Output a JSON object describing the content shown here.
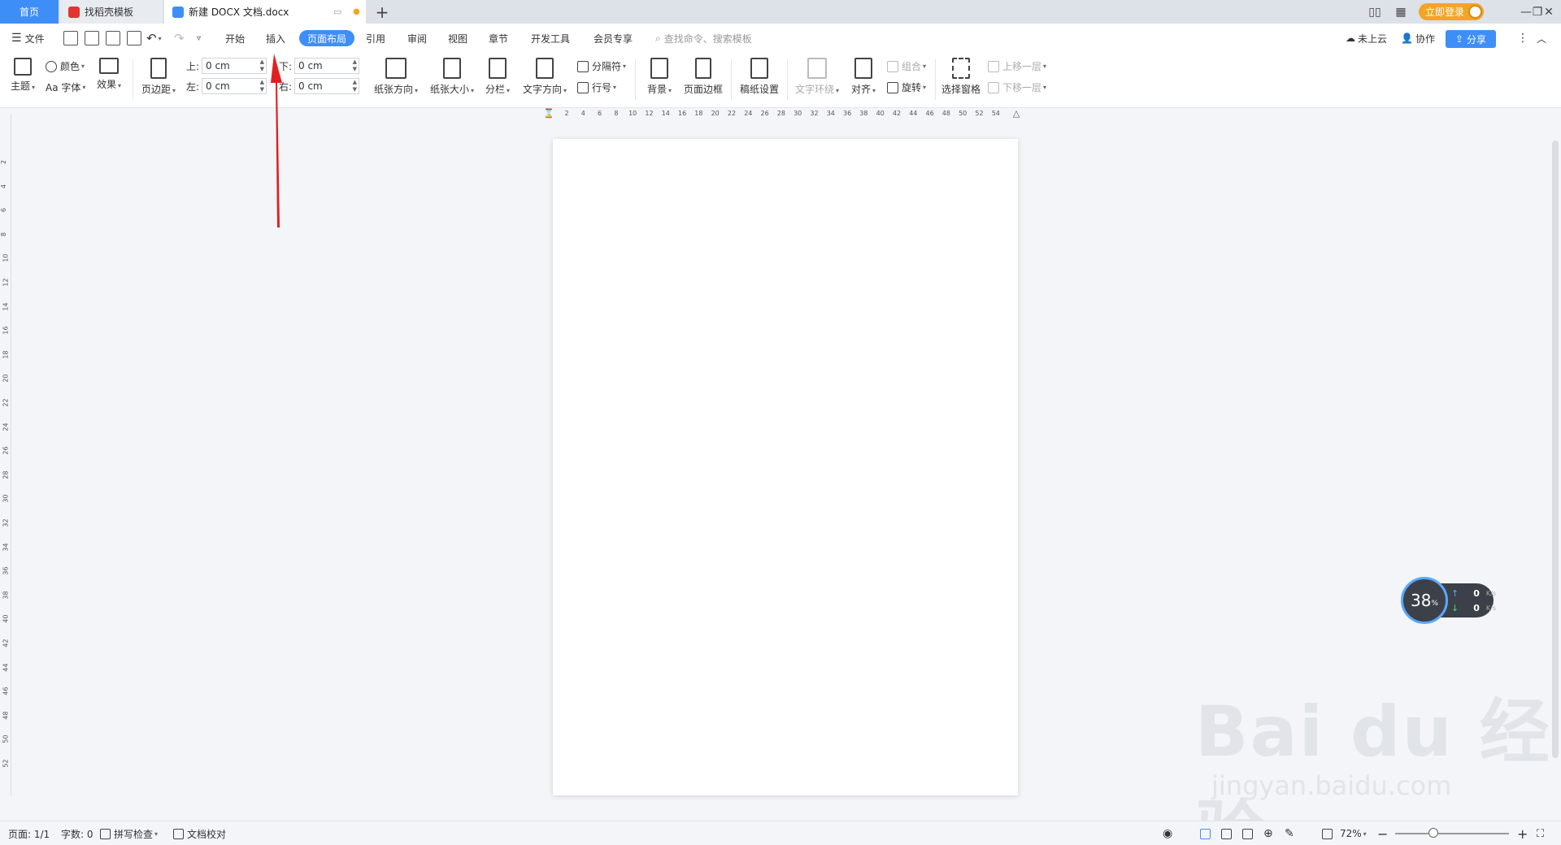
{
  "tabs": {
    "home": "首页",
    "template": "找稻壳模板",
    "document": "新建 DOCX 文档.docx"
  },
  "window": {
    "login_label": "立即登录"
  },
  "menu": {
    "file": "文件",
    "items": [
      "开始",
      "插入",
      "页面布局",
      "引用",
      "审阅",
      "视图",
      "章节",
      "开发工具",
      "会员专享"
    ],
    "active": "页面布局",
    "search_placeholder": "查找命令、搜索模板",
    "cloud": "未上云",
    "collab": "协作",
    "share": "分享"
  },
  "ribbon": {
    "theme": "主题",
    "color": "颜色",
    "font": "Aa 字体",
    "effect": "效果",
    "margins": "页边距",
    "margin_top_label": "上:",
    "margin_top_value": "0 cm",
    "margin_bottom_label": "下:",
    "margin_bottom_value": "0 cm",
    "margin_left_label": "左:",
    "margin_left_value": "0 cm",
    "margin_right_label": "右:",
    "margin_right_value": "0 cm",
    "orientation": "纸张方向",
    "size": "纸张大小",
    "columns": "分栏",
    "text_direction": "文字方向",
    "separator": "分隔符",
    "line_number": "行号",
    "background": "背景",
    "page_border": "页面边框",
    "draft_settings": "稿纸设置",
    "text_wrap": "文字环绕",
    "align": "对齐",
    "group": "组合",
    "rotate": "旋转",
    "selection_pane": "选择窗格",
    "bring_forward": "上移一层",
    "send_backward": "下移一层"
  },
  "ruler": {
    "horizontal": [
      "2",
      "4",
      "6",
      "8",
      "10",
      "12",
      "14",
      "16",
      "18",
      "20",
      "22",
      "24",
      "26",
      "28",
      "30",
      "32",
      "34",
      "36",
      "38",
      "40",
      "42",
      "44",
      "46",
      "48",
      "50",
      "52",
      "54"
    ],
    "vertical": [
      "2",
      "4",
      "6",
      "8",
      "10",
      "12",
      "14",
      "16",
      "18",
      "20",
      "22",
      "24",
      "26",
      "28",
      "30",
      "32",
      "34",
      "36",
      "38",
      "40",
      "42",
      "44",
      "46",
      "48",
      "50",
      "52"
    ]
  },
  "speed_widget": {
    "percent": "38",
    "percent_sign": "%",
    "up": "0",
    "down": "0",
    "unit": "K/s"
  },
  "watermark": {
    "line1": "Bai  du 经验",
    "line2": "jingyan.baidu.com"
  },
  "status": {
    "page": "页面: 1/1",
    "words": "字数: 0",
    "spell": "拼写检查",
    "proof": "文档校对",
    "zoom": "72%"
  },
  "colors": {
    "accent": "#3e8ef7",
    "arrow": "#e02020",
    "login": "#f3a526"
  }
}
